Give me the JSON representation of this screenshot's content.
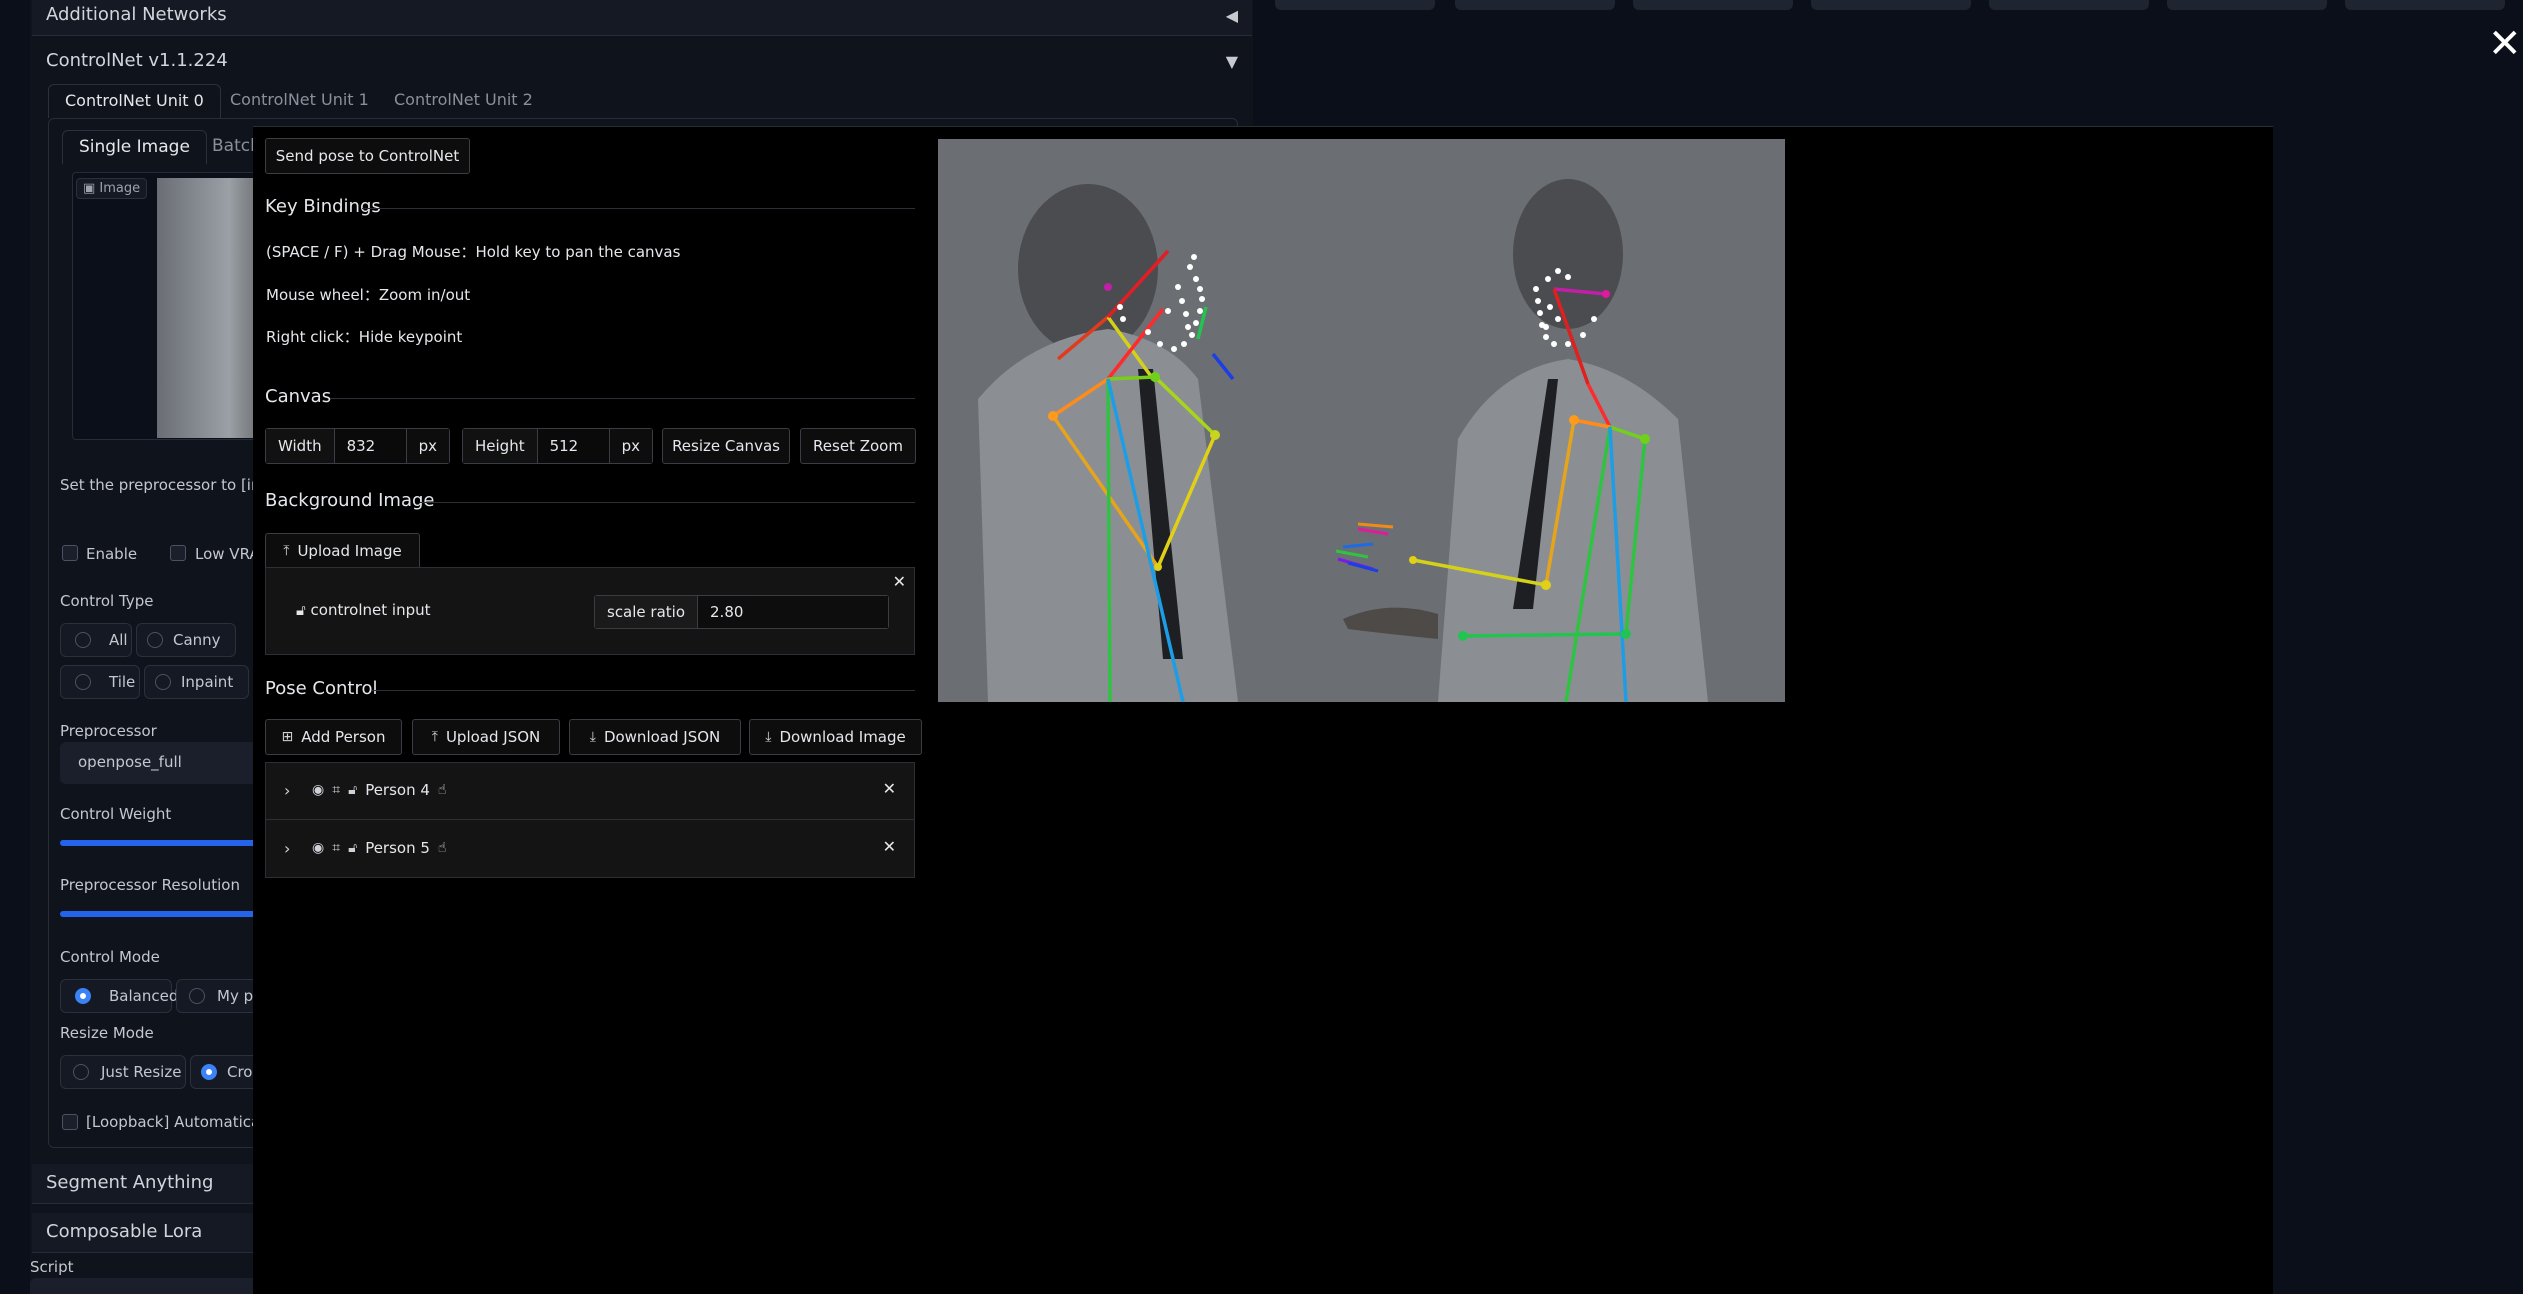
{
  "background": {
    "additional_networks": "Additional Networks",
    "controlnet_title": "ControlNet v1.1.224",
    "unit_tabs": [
      "ControlNet Unit 0",
      "ControlNet Unit 1",
      "ControlNet Unit 2"
    ],
    "inner_tabs": [
      "Single Image",
      "Batch"
    ],
    "image_label": "Image",
    "preprocessor_hint": "Set the preprocessor to [invert",
    "enable_label": "Enable",
    "low_vram_label": "Low VRAI",
    "control_type_label": "Control Type",
    "control_types": [
      "All",
      "Canny",
      "Tile",
      "Inpaint"
    ],
    "preprocessor_label": "Preprocessor",
    "preprocessor_value": "openpose_full",
    "control_weight_label": "Control Weight",
    "preprocessor_resolution_label": "Preprocessor Resolution",
    "control_mode_label": "Control Mode",
    "control_modes": [
      "Balanced",
      "My pr"
    ],
    "resize_mode_label": "Resize Mode",
    "resize_modes": [
      "Just Resize",
      "Crop"
    ],
    "loopback_label": "[Loopback] Automatically",
    "segment_anything": "Segment Anything",
    "composable_lora": "Composable Lora",
    "script_label": "Script"
  },
  "modal": {
    "close_label": "✕",
    "send_pose_button": "Send pose to ControlNet",
    "key_bindings_title": "Key Bindings",
    "key_bindings": [
      "(SPACE / F) + Drag Mouse：Hold key to pan the canvas",
      "Mouse wheel：Zoom in/out",
      "Right click：Hide keypoint"
    ],
    "canvas_title": "Canvas",
    "width_label": "Width",
    "width_value": "832",
    "height_label": "Height",
    "height_value": "512",
    "unit_px": "px",
    "resize_canvas_button": "Resize Canvas",
    "reset_zoom_button": "Reset Zoom",
    "background_image_title": "Background Image",
    "upload_image_button": "Upload Image",
    "bg_layer_name": "controlnet input",
    "scale_ratio_label": "scale ratio",
    "scale_ratio_value": "2.80",
    "pose_control_title": "Pose Control",
    "add_person_button": "Add Person",
    "upload_json_button": "Upload JSON",
    "download_json_button": "Download JSON",
    "download_image_button": "Download Image",
    "persons": [
      "Person 4",
      "Person 5"
    ]
  },
  "icons": {
    "upload": "upload-icon",
    "download": "download-icon",
    "add": "plus-square-icon",
    "eye": "eye-icon",
    "focus": "focus-icon",
    "lock": "lock-icon",
    "hand": "hand-icon"
  }
}
